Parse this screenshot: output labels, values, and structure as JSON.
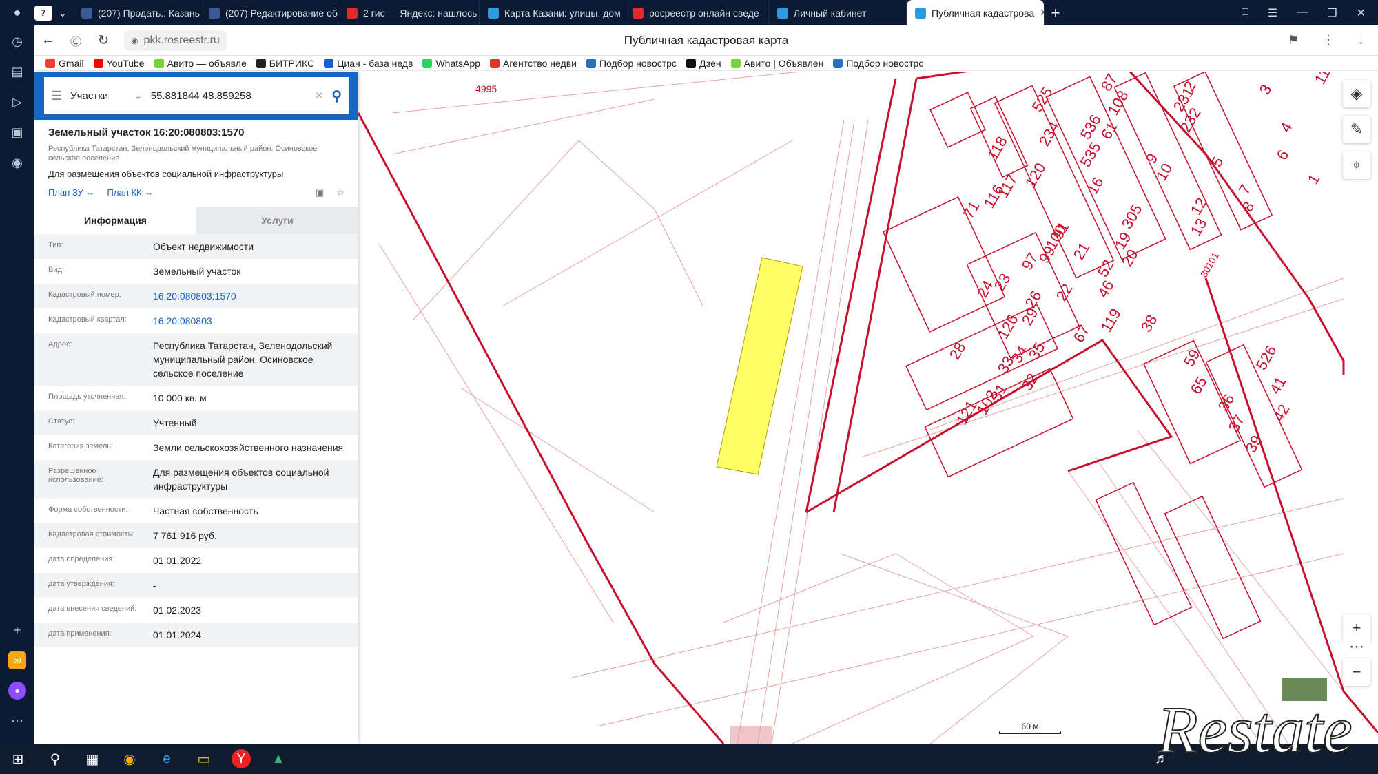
{
  "browser": {
    "tab_count": "7",
    "tabs": [
      {
        "title": "(207) Продать.: Казань",
        "color": "#3b5998"
      },
      {
        "title": "(207) Редактирование об",
        "color": "#3b5998"
      },
      {
        "title": "2 гис — Яндекс: нашлось",
        "color": "#e02b2b"
      },
      {
        "title": "Карта Казани: улицы, дом",
        "color": "#2c9be6"
      },
      {
        "title": "росреестр онлайн сведе",
        "color": "#e02b2b"
      },
      {
        "title": "Личный кабинет",
        "color": "#2c9be6"
      },
      {
        "title": "Публичная кадастрова",
        "color": "#2c9be6"
      }
    ],
    "url": "pkk.rosreestr.ru",
    "page_title": "Публичная кадастровая карта",
    "bookmarks": [
      {
        "label": "Gmail",
        "color": "#ea4335"
      },
      {
        "label": "YouTube",
        "color": "#ff0000"
      },
      {
        "label": "Авито — объявле",
        "color": "#7fcf3a"
      },
      {
        "label": "БИТРИКС",
        "color": "#222222"
      },
      {
        "label": "Циан - база недв",
        "color": "#1a5bd8"
      },
      {
        "label": "WhatsApp",
        "color": "#25d366"
      },
      {
        "label": "Агентство недви",
        "color": "#e0362b"
      },
      {
        "label": "Подбор новострс",
        "color": "#2a6fb8"
      },
      {
        "label": "Дзен",
        "color": "#111111"
      },
      {
        "label": "Авито | Объявлен",
        "color": "#7fcf3a"
      },
      {
        "label": "Подбор новострс",
        "color": "#2a6fb8"
      }
    ]
  },
  "search": {
    "category": "Участки",
    "query": "55.881844 48.859258"
  },
  "object": {
    "title": "Земельный участок 16:20:080803:1570",
    "region": "Республика Татарстан, Зеленодольский муниципальный район, Осиновское сельское поселение",
    "purpose": "Для размещения объектов социальной инфраструктуры",
    "link_plan_zu": "План ЗУ →",
    "link_plan_kk": "План КК →"
  },
  "tabs": {
    "info": "Информация",
    "services": "Услуги"
  },
  "fields": [
    {
      "k": "Тип:",
      "v": "Объект недвижимости"
    },
    {
      "k": "Вид:",
      "v": "Земельный участок"
    },
    {
      "k": "Кадастровый номер:",
      "v": "16:20:080803:1570",
      "link": true
    },
    {
      "k": "Кадастровый квартал:",
      "v": "16:20:080803",
      "link": true
    },
    {
      "k": "Адрес:",
      "v": "Республика Татарстан, Зеленодольский муниципальный район, Осиновское сельское поселение"
    },
    {
      "k": "Площадь уточненная:",
      "v": "10 000 кв. м"
    },
    {
      "k": "Статус:",
      "v": "Учтенный"
    },
    {
      "k": "Категория земель:",
      "v": "Земли сельскохозяйственного назначения"
    },
    {
      "k": "Разрешенное использование:",
      "v": "Для размещения объектов социальной инфраструктуры"
    },
    {
      "k": "Форма собственности:",
      "v": "Частная собственность"
    },
    {
      "k": "Кадастровая стоимость:",
      "v": "7 761 916 руб."
    },
    {
      "k": "дата определения:",
      "v": "01.01.2022"
    },
    {
      "k": "дата утверждения:",
      "v": "-"
    },
    {
      "k": "дата внесения сведений:",
      "v": "01.02.2023"
    },
    {
      "k": "дата применения:",
      "v": "01.01.2024"
    }
  ],
  "map": {
    "labels": [
      "4995",
      "80101",
      "525",
      "234",
      "536",
      "535",
      "118",
      "120",
      "116",
      "117",
      "71",
      "16",
      "305",
      "19",
      "20",
      "13",
      "12",
      "10",
      "9",
      "61",
      "108",
      "87",
      "231",
      "232",
      "5",
      "7",
      "8",
      "6",
      "4",
      "3",
      "2",
      "1",
      "11",
      "91",
      "21",
      "97",
      "99",
      "100",
      "52",
      "46",
      "22",
      "26",
      "23",
      "24",
      "29",
      "126",
      "119",
      "67",
      "35",
      "34",
      "33",
      "32",
      "31",
      "102",
      "121",
      "28",
      "38",
      "59",
      "65",
      "36",
      "37",
      "39",
      "526",
      "41",
      "42"
    ],
    "scale": "60 м",
    "highlight_color": "#ffff66",
    "line_color": "#c8102e"
  },
  "watermark": "Restate"
}
